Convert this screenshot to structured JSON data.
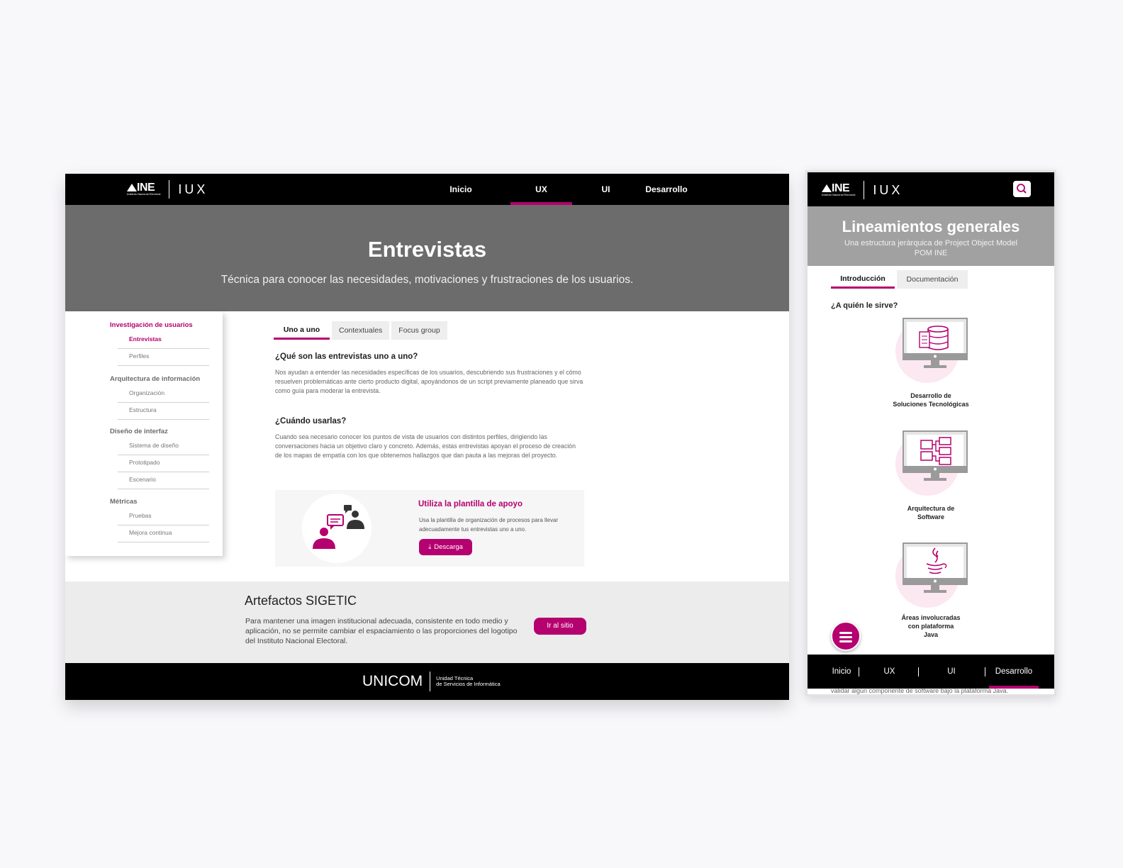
{
  "desktop": {
    "header": {
      "logo_text": "INE",
      "logo_subtext": "Instituto Nacional Electoral",
      "product": "IUX",
      "nav": [
        {
          "label": "Inicio",
          "active": false
        },
        {
          "label": "UX",
          "active": true
        },
        {
          "label": "UI",
          "active": false
        },
        {
          "label": "Desarrollo",
          "active": false
        }
      ]
    },
    "hero": {
      "title": "Entrevistas",
      "subtitle": "Técnica para conocer las necesidades, motivaciones y frustraciones de los usuarios."
    },
    "sidebar": {
      "groups": [
        {
          "heading": "Investigación de usuarios",
          "active": true,
          "items": [
            "Entrevistas",
            "Perfiles"
          ]
        },
        {
          "heading": "Arquitectura de información",
          "active": false,
          "items": [
            "Organización",
            "Estructura"
          ]
        },
        {
          "heading": "Diseño de interfaz",
          "active": false,
          "items": [
            "Sistema de diseño",
            "Prototipado",
            "Escenario"
          ]
        },
        {
          "heading": "Métricas",
          "active": false,
          "items": [
            "Pruebas",
            "Mejora continua"
          ]
        }
      ],
      "active_item": "Entrevistas"
    },
    "tabs": [
      "Uno a uno",
      "Contextuales",
      "Focus group"
    ],
    "active_tab": "Uno a uno",
    "content": {
      "q1": "¿Qué son las entrevistas uno a uno?",
      "p1": "Nos ayudan a entender las necesidades específicas de los usuarios, descubriendo sus frustraciones y el cómo resuelven problemáticas ante cierto producto digital, apoyándonos de un script previamente planeado que sirva como guía para moderar la entrevista.",
      "q2": "¿Cuándo usarlas?",
      "p2": "Cuando sea necesario conocer los puntos de vista de usuarios con distintos perfiles, dirigiendo las conversaciones hacia un objetivo claro y concreto. Además, estas entrevistas apoyan el proceso de creación de los mapas de empatía con los que obtenemos hallazgos que dan pauta a las mejoras del proyecto."
    },
    "template": {
      "title": "Utiliza la plantilla de apoyo",
      "text": "Usa la plantilla de organización de procesos para llevar adecuadamente tus entrevistas uno a uno.",
      "button": "Descarga"
    },
    "artefactos": {
      "title": "Artefactos SIGETIC",
      "text": "Para mantener una imagen institucional adecuada, consistente en todo medio y aplicación, no se permite cambiar el espaciamiento o las proporciones del logotipo del Instituto Nacional Electoral.",
      "button": "Ir al sitio"
    },
    "footer": {
      "brand": "UNICOM",
      "line1": "Unidad Técnica",
      "line2": "de Servicios de Informática"
    }
  },
  "mobile": {
    "header": {
      "logo_text": "INE",
      "logo_subtext": "Instituto Nacional Electoral",
      "product": "IUX"
    },
    "hero": {
      "title": "Lineamientos generales",
      "subtitle_line1": "Una estructura jerárquica de Project Object Model",
      "subtitle_line2": "POM INE"
    },
    "tabs": [
      "Introducción",
      "Documentación"
    ],
    "active_tab": "Introducción",
    "question": "¿A quién le sirve?",
    "cards": [
      {
        "line1": "Desarrollo de",
        "line2": "Soluciones Tecnológicas",
        "line3": "",
        "icon": "database-monitor-icon"
      },
      {
        "line1": "Arquitectura de",
        "line2": "Software",
        "line3": "",
        "icon": "architecture-monitor-icon"
      },
      {
        "line1": "Áreas involucradas",
        "line2": "con plataforma",
        "line3": "Java",
        "icon": "java-monitor-icon"
      }
    ],
    "footer_nav": [
      {
        "label": "Inicio",
        "active": false
      },
      {
        "label": "UX",
        "active": false
      },
      {
        "label": "UI",
        "active": false
      },
      {
        "label": "Desarrollo",
        "active": true
      }
    ],
    "cutoff_text": "validar algún componente de software bajo la plataforma Java."
  },
  "colors": {
    "accent": "#b5006f",
    "nav_bg": "#000000",
    "hero_bg": "#6c6c6c",
    "mobile_hero_bg": "#a1a1a1"
  }
}
